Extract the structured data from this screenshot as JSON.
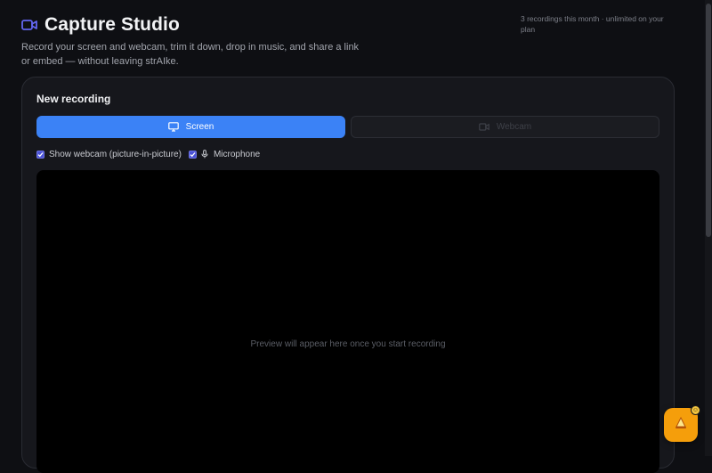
{
  "header": {
    "title": "Capture Studio",
    "subtitle": "Record your screen and webcam, trim it down, drop in music, and share a link or embed — without leaving strAIke.",
    "usage": "3 recordings this month · unlimited on your plan",
    "icon": "video-camera-icon",
    "accent": "#6366f1"
  },
  "recording": {
    "title": "New recording",
    "modes": [
      {
        "label": "Screen",
        "icon": "monitor-icon",
        "active": true
      },
      {
        "label": "Webcam",
        "icon": "video-camera-icon",
        "active": false
      }
    ],
    "options": {
      "webcam_pip": {
        "label": "Show webcam (picture-in-picture)",
        "checked": true
      },
      "microphone": {
        "label": "Microphone",
        "checked": true,
        "icon": "microphone-icon"
      }
    },
    "preview_text": "Preview will appear here once you start recording"
  },
  "colors": {
    "primary": "#3b82f6",
    "background": "#0e0f13",
    "card": "#16171c",
    "fab": "#f59e0b"
  }
}
